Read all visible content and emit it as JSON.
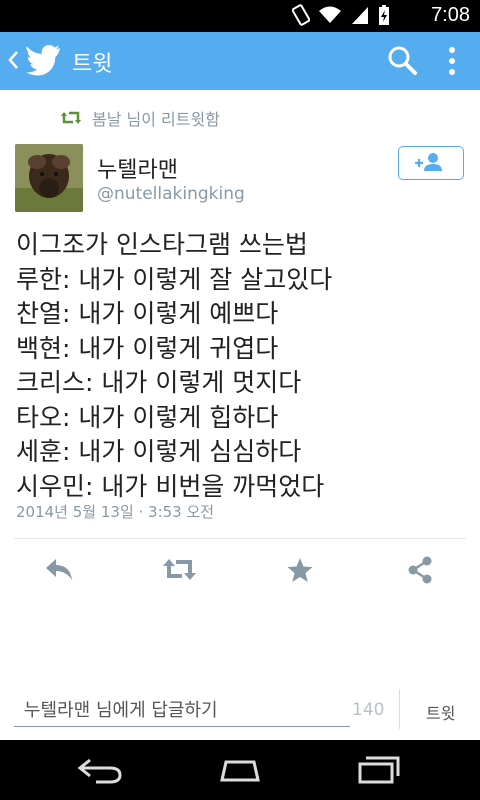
{
  "status_bar": {
    "time": "7:08"
  },
  "action_bar": {
    "title": "트윗",
    "icons": [
      "back-arrow-icon",
      "twitter-bird-icon",
      "search-icon",
      "overflow-menu-icon"
    ]
  },
  "retweet_context": {
    "text": "봄날 님이 리트윗함"
  },
  "author": {
    "display_name": "누텔라맨",
    "handle": "@nutellakingking"
  },
  "tweet": {
    "lines": [
      "이그조가 인스타그램 쓰는법",
      "루한: 내가 이렇게 잘 살고있다",
      "찬열: 내가 이렇게 예쁘다",
      "백현: 내가 이렇게 귀엽다",
      "크리스: 내가 이렇게 멋지다",
      "타오: 내가 이렇게 힙하다",
      "세훈: 내가 이렇게 심심하다",
      "시우민: 내가 비번을 까먹었다"
    ],
    "timestamp": "2014년 5월 13일 · 3:53 오전"
  },
  "actions": [
    "reply-icon",
    "retweet-icon",
    "favorite-icon",
    "share-icon"
  ],
  "composer": {
    "placeholder": "누텔라맨 님에게 답글하기",
    "char_count": "140",
    "submit_label": "트윗"
  },
  "colors": {
    "brand": "#55acee",
    "muted": "#8899a6"
  }
}
